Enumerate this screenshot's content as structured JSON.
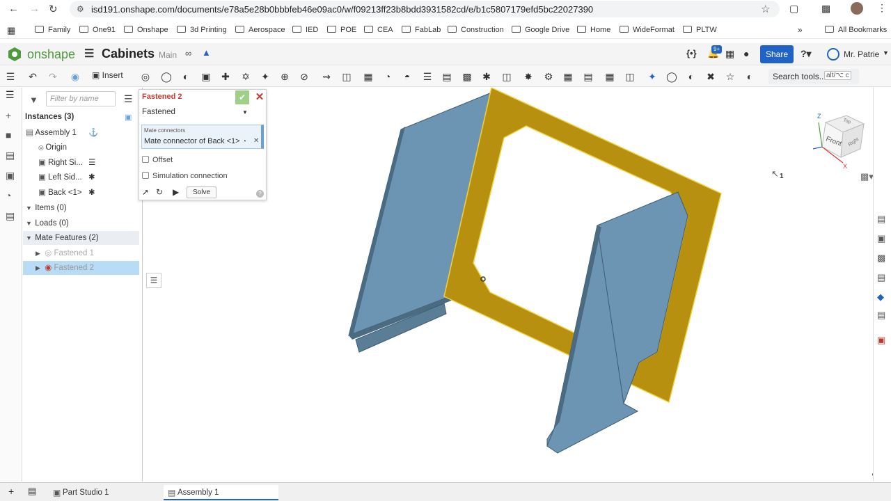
{
  "browser": {
    "url": "isd191.onshape.com/documents/e78a5e28b0bbbfeb46e09ac0/w/f09213ff23b8bdd3931582cd/e/b1c5807179efd5bc22027390",
    "bookmarks": [
      "Family",
      "One91",
      "Onshape",
      "3d Printing",
      "Aerospace",
      "IED",
      "POE",
      "CEA",
      "FabLab",
      "Construction",
      "Google Drive",
      "Home",
      "WideFormat",
      "PLTW"
    ],
    "all_bookmarks": "All Bookmarks"
  },
  "app": {
    "brand": "onshape",
    "doc_title": "Cabinets",
    "branch": "Main",
    "notif_count": "9+",
    "share_label": "Share",
    "user_name": "Mr. Patrie"
  },
  "toolbar": {
    "insert_label": "Insert",
    "search_label": "Search tools...",
    "search_shortcut": "alt/⌥ c"
  },
  "panel": {
    "filter_placeholder": "Filter by name",
    "instances_label": "Instances (3)",
    "assembly_label": "Assembly 1",
    "origin_label": "Origin",
    "right_side_label": "Right Si...",
    "left_side_label": "Left Sid...",
    "back_label": "Back <1>",
    "items_label": "Items (0)",
    "loads_label": "Loads (0)",
    "mate_features_label": "Mate Features (2)",
    "fastened1_label": "Fastened 1",
    "fastened2_label": "Fastened 2"
  },
  "dialog": {
    "title": "Fastened 2",
    "type_value": "Fastened",
    "mate_connectors_label": "Mate connectors",
    "mate_connector_value": "Mate connector of Back <1>",
    "offset_label": "Offset",
    "simulation_label": "Simulation connection",
    "solve_label": "Solve"
  },
  "viewcube": {
    "top": "Top",
    "front": "Front",
    "right": "Right",
    "axis_z": "Z",
    "axis_x": "X"
  },
  "cursor_count": "1",
  "tabs": {
    "part_studio": "Part Studio 1",
    "assembly": "Assembly 1"
  },
  "colors": {
    "brand_green": "#4e9a3d",
    "share_blue": "#2063c4",
    "selected_row": "#b8dcf5",
    "part_blue": "#6c95b3",
    "highlight_gold": "#b8900f",
    "error_red": "#c0392b"
  }
}
